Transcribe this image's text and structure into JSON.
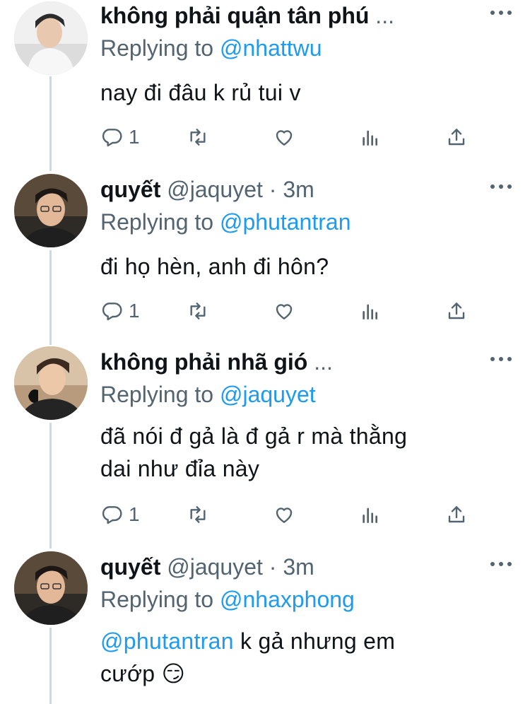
{
  "tweets": [
    {
      "name": "không phải quận tân phú",
      "name_suffix": "...",
      "handle": "",
      "time": "",
      "replying_prefix": "Replying to",
      "replying_to": "@nhattwu",
      "body_lines": [
        "nay đi đâu k rủ tui v"
      ],
      "reply_count": "1",
      "avatar_style": "light"
    },
    {
      "name": "quyết",
      "name_suffix": "",
      "handle": "@jaquyet",
      "time": "3m",
      "replying_prefix": "Replying to",
      "replying_to": "@phutantran",
      "body_lines": [
        "đi họ hèn, anh đi hôn?"
      ],
      "reply_count": "1",
      "avatar_style": "dark"
    },
    {
      "name": "không phải nhã gió",
      "name_suffix": "...",
      "handle": "",
      "time": "",
      "replying_prefix": "Replying to",
      "replying_to": "@jaquyet",
      "body_lines": [
        "đã nói đ gả là đ gả r mà thằng",
        "dai như đỉa này"
      ],
      "reply_count": "1",
      "avatar_style": "warm"
    },
    {
      "name": "quyết",
      "name_suffix": "",
      "handle": "@jaquyet",
      "time": "3m",
      "replying_prefix": "Replying to",
      "replying_to": "@nhaxphong",
      "body_mention": "@phutantran",
      "body_lines": [
        " k gả nhưng em",
        "cướp 😏"
      ],
      "reply_count": "",
      "avatar_style": "dark"
    }
  ],
  "dot_separator": "·",
  "icons": [
    "reply-icon",
    "retweet-icon",
    "like-icon",
    "analytics-icon",
    "share-icon",
    "more-icon"
  ],
  "colors": {
    "text": "#0f1419",
    "secondary": "#536471",
    "link": "#1d9bf0",
    "thread_line": "#cfd9de"
  }
}
